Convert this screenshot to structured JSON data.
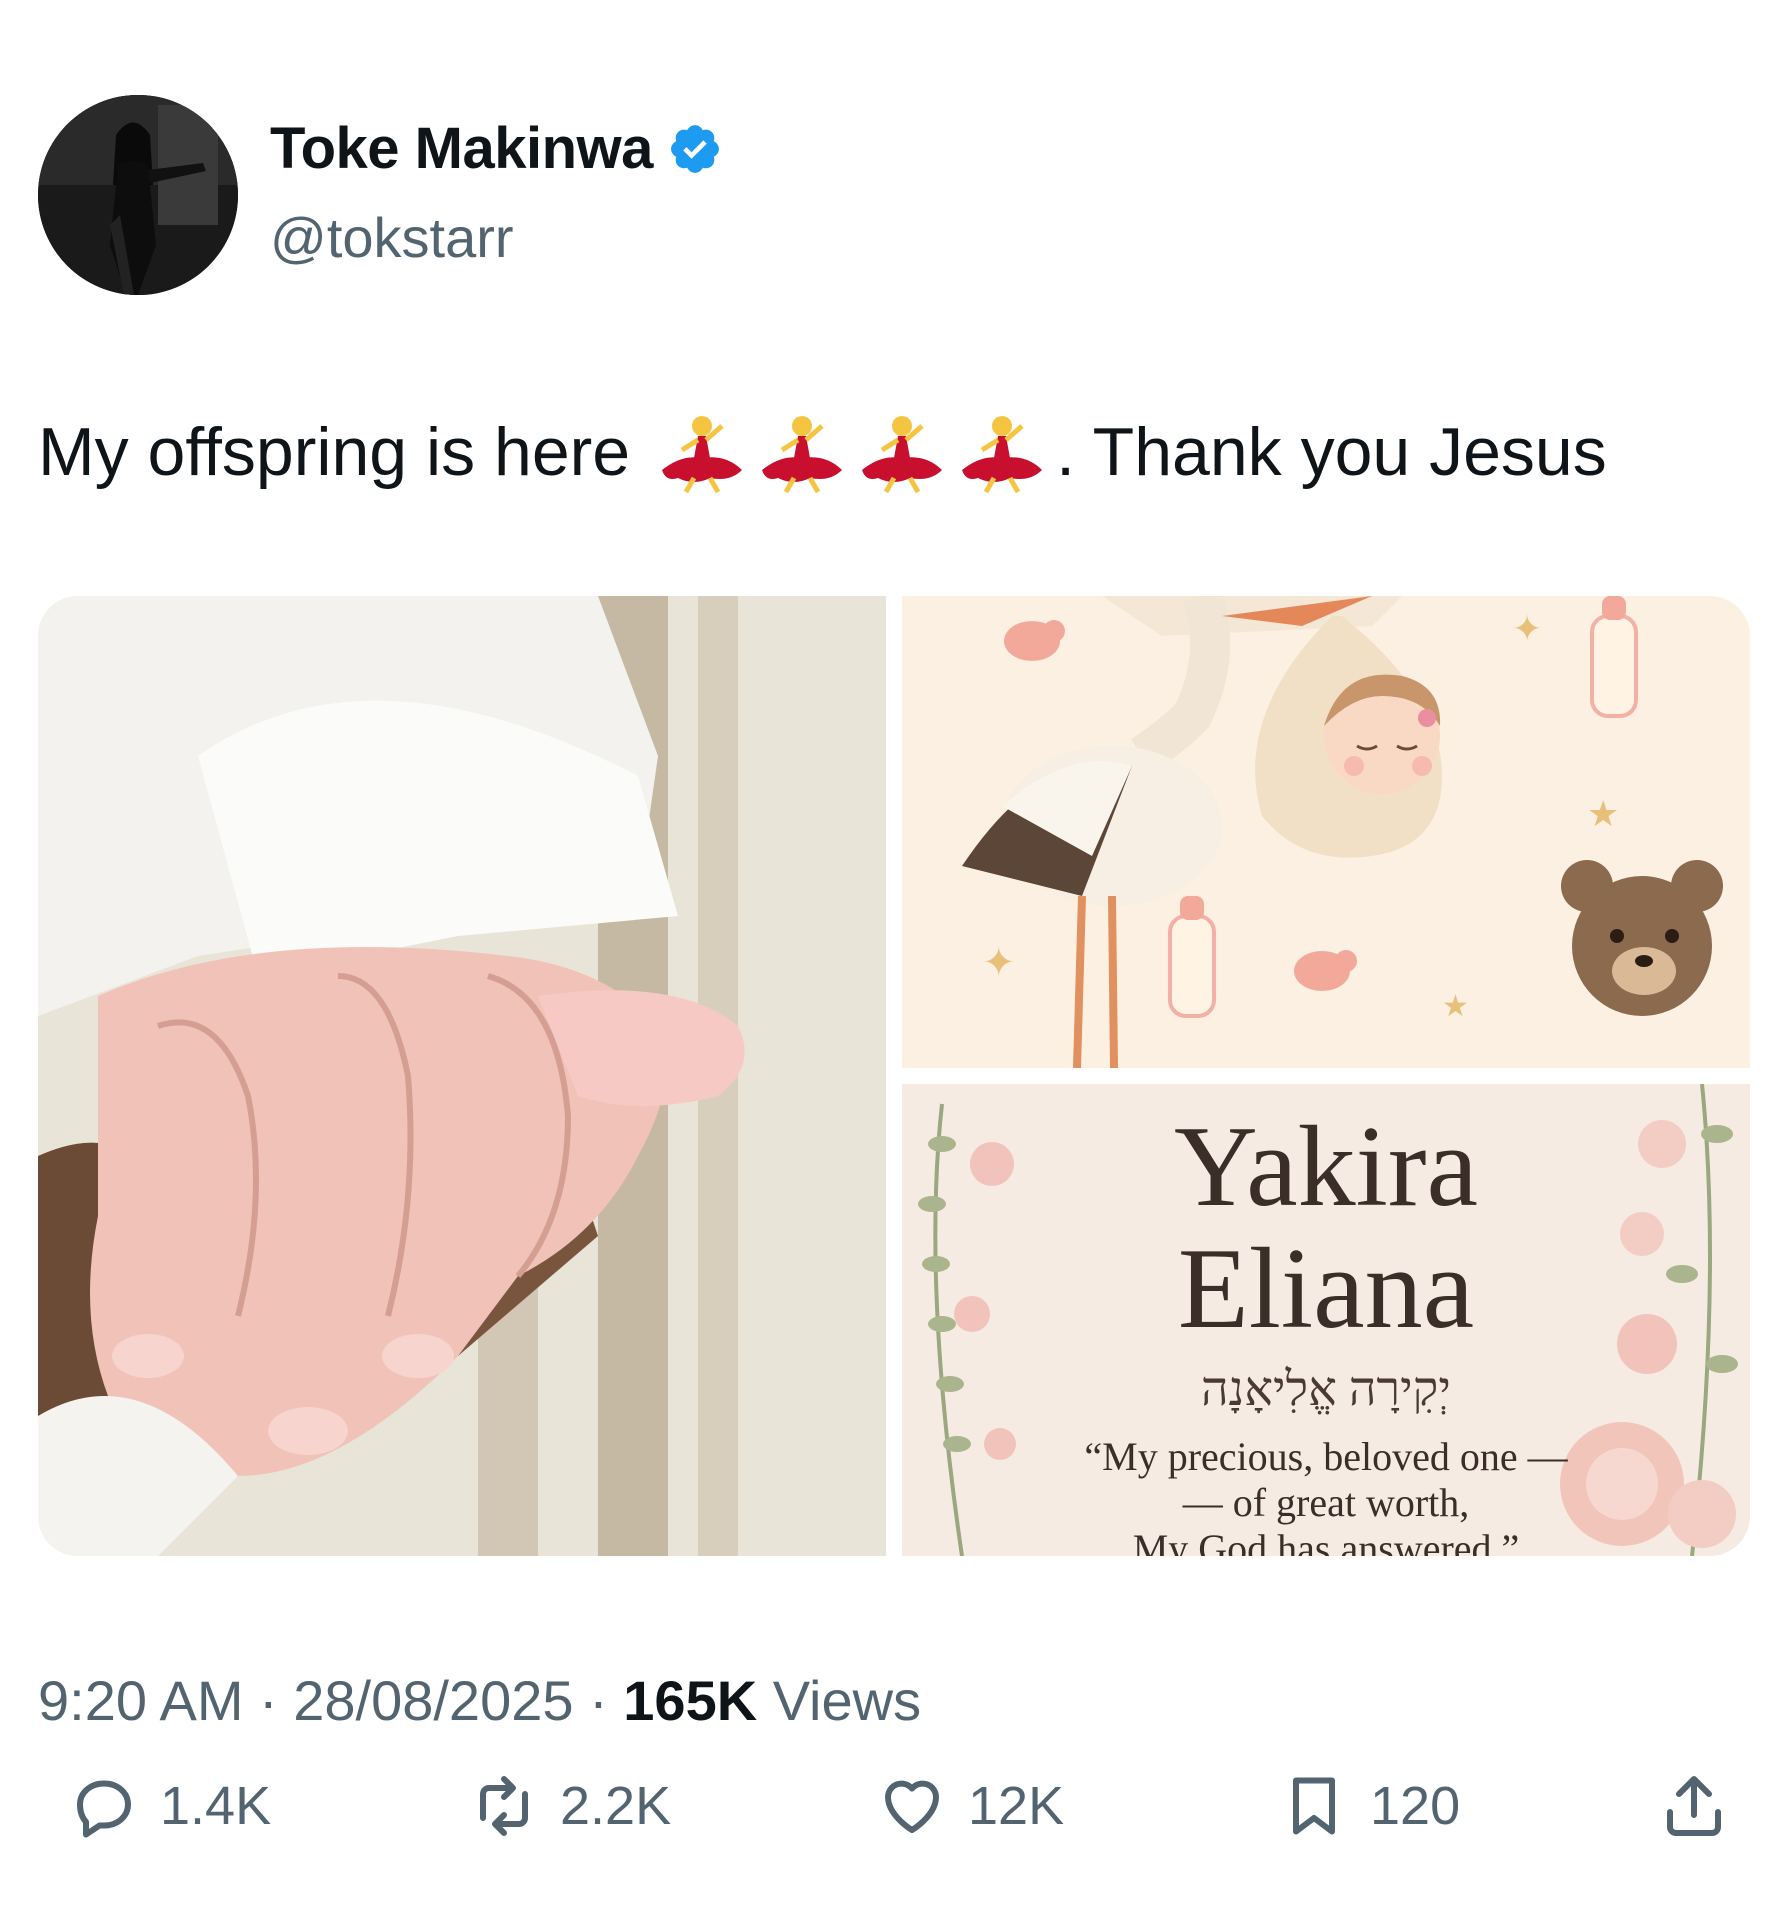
{
  "user": {
    "name": "Toke Makinwa",
    "handle": "@tokstarr",
    "verified": true
  },
  "tweet": {
    "text_before": "My offspring is here",
    "emoji": "dancer-emoji",
    "emoji_count": 4,
    "text_after": ". Thank you Jesus"
  },
  "media": {
    "card_name_first": "Yakira",
    "card_name_last": "Eliana",
    "card_hebrew": "יְקִירָה אֱלִיאָנָה",
    "card_quote_line1": "“My precious, beloved one —",
    "card_quote_line2": "— of great worth,",
    "card_quote_line3": "My God has answered.”"
  },
  "meta": {
    "time": "9:20 AM",
    "sep1": " · ",
    "date": "28/08/2025",
    "sep2": " · ",
    "views_count": "165K",
    "views_label": " Views"
  },
  "actions": {
    "replies": "1.4K",
    "reposts": "2.2K",
    "likes": "12K",
    "bookmarks": "120"
  },
  "colors": {
    "verified": "#1d9bf0",
    "secondary_text": "#536471",
    "primary_text": "#0f1419"
  }
}
